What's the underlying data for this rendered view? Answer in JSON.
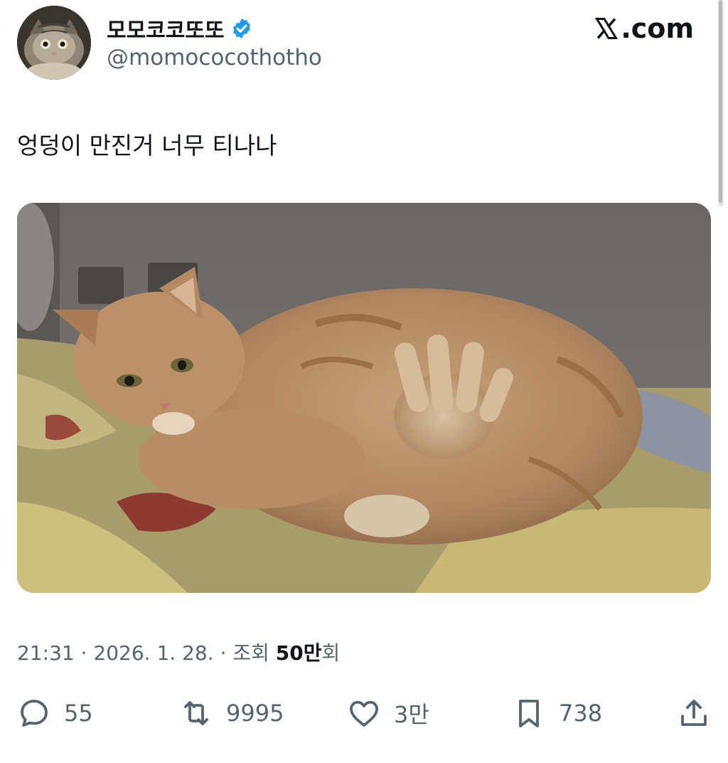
{
  "header": {
    "display_name": "모모코코또또",
    "handle": "@momococothotho",
    "brand": ".com"
  },
  "tweet": {
    "text": "엉덩이 만진거 너무 티나나"
  },
  "meta": {
    "time": "21:31",
    "date": "2026. 1. 28.",
    "views_label": "조회",
    "views_count": "50만",
    "views_suffix": "회",
    "separator": "·"
  },
  "actions": {
    "replies": "55",
    "retweets": "9995",
    "likes": "3만",
    "bookmarks": "738"
  },
  "colors": {
    "text": "#0f1419",
    "secondary": "#536471",
    "verified": "#1d9bf0"
  },
  "icons": {
    "verified": "verified-badge-icon",
    "brand": "x-logo-icon",
    "reply": "reply-icon",
    "retweet": "retweet-icon",
    "like": "heart-icon",
    "bookmark": "bookmark-icon",
    "share": "share-icon"
  }
}
